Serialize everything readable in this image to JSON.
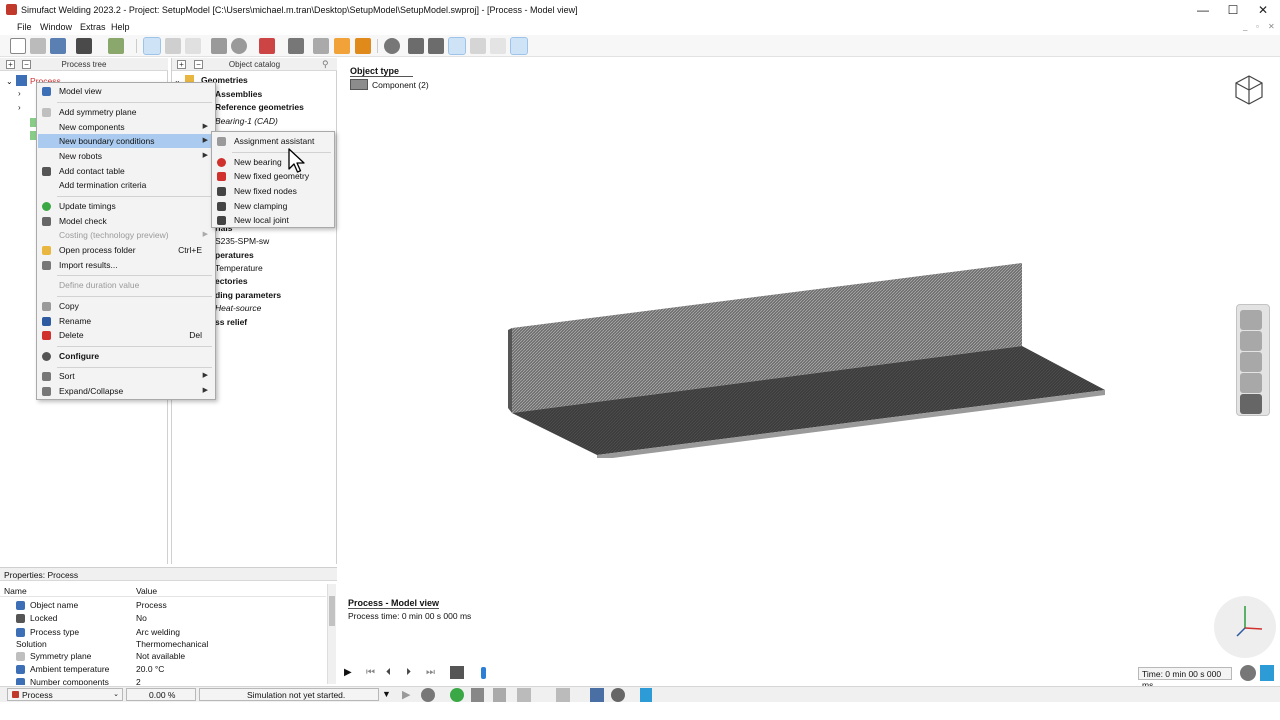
{
  "window": {
    "title": "Simufact Welding 2023.2 - Project: SetupModel [C:\\Users\\michael.m.tran\\Desktop\\SetupModel\\SetupModel.swproj]  - [Process - Model view]",
    "minimize": "—",
    "maximize": "☐",
    "close": "✕"
  },
  "menubar": {
    "items": [
      "File",
      "Window",
      "Extras",
      "Help"
    ],
    "right_controls": [
      "_",
      "▫",
      "✕"
    ]
  },
  "panels": {
    "process_tree_title": "Process tree",
    "object_catalog_title": "Object catalog",
    "tree_root_label": "Process"
  },
  "catalog": {
    "items": [
      {
        "text": "Geometries",
        "style": "b"
      },
      {
        "text": "Assemblies",
        "style": "b"
      },
      {
        "text": "Reference geometries",
        "style": "b"
      },
      {
        "text": "Bearing-1 (CAD)",
        "style": "i"
      },
      {
        "text": "S235-SPM-sw",
        "style": ""
      },
      {
        "text": "peratures",
        "style": "b"
      },
      {
        "text": "Temperature",
        "style": ""
      },
      {
        "text": "ectories",
        "style": "b"
      },
      {
        "text": "ding parameters",
        "style": "b"
      },
      {
        "text": "Heat-source",
        "style": "i"
      },
      {
        "text": "ss relief",
        "style": "b"
      }
    ],
    "partial_label": "rials"
  },
  "context_menu": {
    "items": [
      {
        "label": "Model view",
        "icon": "model-view-icon",
        "color": "#3d6fb6"
      },
      {
        "label": "Add symmetry plane",
        "icon": "symmetry-plane-icon",
        "color": "#bfbfbf"
      },
      {
        "label": "New components",
        "arrow": "▶"
      },
      {
        "label": "New boundary conditions",
        "arrow": "▶",
        "highlight": true
      },
      {
        "label": "New robots",
        "arrow": "▶"
      },
      {
        "label": "Add contact table",
        "icon": "contact-table-icon",
        "color": "#555555"
      },
      {
        "label": "Add termination criteria"
      },
      {
        "label": "Update timings",
        "icon": "update-timings-icon",
        "color": "#39a845"
      },
      {
        "label": "Model check",
        "icon": "model-check-icon",
        "color": "#666666"
      },
      {
        "label": "Costing (technology preview)",
        "arrow": "▶",
        "disabled": true
      },
      {
        "label": "Open process folder",
        "shortcut": "Ctrl+E",
        "icon": "folder-icon",
        "color": "#e9b640"
      },
      {
        "label": "Import results...",
        "icon": "import-results-icon",
        "color": "#777777"
      },
      {
        "label": "Define duration value",
        "disabled": true
      },
      {
        "label": "Copy",
        "icon": "copy-icon",
        "color": "#9a9a9a"
      },
      {
        "label": "Rename",
        "icon": "rename-icon",
        "color": "#2d5aa0"
      },
      {
        "label": "Delete",
        "shortcut": "Del",
        "icon": "delete-icon",
        "color": "#d0312d"
      },
      {
        "label": "Configure",
        "icon": "gear-icon",
        "color": "#555555",
        "bold": true
      },
      {
        "label": "Sort",
        "arrow": "▶",
        "icon": "sort-icon",
        "color": "#777777"
      },
      {
        "label": "Expand/Collapse",
        "arrow": "▶",
        "icon": "expand-collapse-icon",
        "color": "#777777"
      }
    ]
  },
  "submenu": {
    "items": [
      {
        "label": "Assignment assistant",
        "icon": "assignment-assistant-icon",
        "color": "#9a9a9a"
      },
      {
        "label": "New bearing",
        "icon": "bearing-icon",
        "color": "#d0312d"
      },
      {
        "label": "New fixed geometry",
        "icon": "fixed-geometry-icon",
        "color": "#d0312d"
      },
      {
        "label": "New fixed nodes",
        "icon": "fixed-nodes-icon",
        "color": "#444444"
      },
      {
        "label": "New clamping",
        "icon": "clamping-icon",
        "color": "#444444"
      },
      {
        "label": "New local joint",
        "icon": "local-joint-icon",
        "color": "#444444"
      }
    ]
  },
  "viewport": {
    "object_type_title": "Object type",
    "legend_label": "Component (2)",
    "legend_color": "#8c8c8c",
    "view_name": "Process - Model view",
    "process_time": "Process time: 0 min 00 s 000 ms"
  },
  "properties": {
    "title": "Properties: Process",
    "col_name": "Name",
    "col_value": "Value",
    "rows": [
      {
        "name": "Object name",
        "value": "Process",
        "icon": "object-name-icon",
        "color": "#3d6fb6"
      },
      {
        "name": "Locked",
        "value": "No",
        "icon": "lock-icon",
        "color": "#555555"
      },
      {
        "name": "Process type",
        "value": "Arc welding",
        "icon": "process-type-icon",
        "color": "#3d6fb6"
      },
      {
        "name": "Solution",
        "value": "Thermomechanical",
        "icon": ""
      },
      {
        "name": "Symmetry plane",
        "value": "Not available",
        "icon": "symmetry-plane-icon",
        "color": "#bfbfbf"
      },
      {
        "name": "Ambient temperature",
        "value": "20.0 °C",
        "icon": "temperature-icon",
        "color": "#3d6fb6"
      },
      {
        "name": "Number components",
        "value": "2",
        "icon": "components-icon",
        "color": "#3d6fb6"
      }
    ]
  },
  "playback": {
    "time_display": "Time: 0 min 00 s 000 ms"
  },
  "status": {
    "process_select": "Process",
    "progress": "0.00 %",
    "simulation": "Simulation not yet started."
  }
}
